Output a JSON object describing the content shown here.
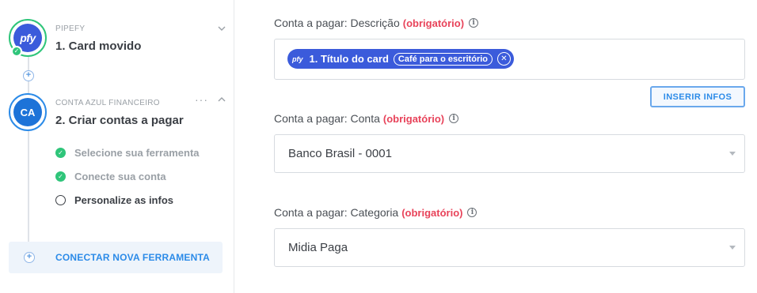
{
  "sidebar": {
    "steps": [
      {
        "app": "PIPEFY",
        "title": "1. Card movido",
        "avatar_text": "pfy",
        "status": "done"
      },
      {
        "app": "CONTA AZUL FINANCEIRO",
        "title": "2. Criar contas a pagar",
        "avatar_text": "CA",
        "more": "···",
        "substeps": [
          {
            "label": "Selecione sua ferramenta",
            "state": "done"
          },
          {
            "label": "Conecte sua conta",
            "state": "done"
          },
          {
            "label": "Personalize as infos",
            "state": "current"
          }
        ]
      }
    ],
    "connect_button": "CONECTAR NOVA FERRAMENTA"
  },
  "form": {
    "fields": [
      {
        "label": "Conta a pagar: Descrição",
        "required": "(obrigatório)",
        "token": {
          "app": "pfy",
          "name": "1. Título do card",
          "value": "Café para o escritório"
        }
      },
      {
        "label": "Conta a pagar: Conta",
        "required": "(obrigatório)",
        "value": "Banco Brasil - 0001"
      },
      {
        "label": "Conta a pagar: Categoria",
        "required": "(obrigatório)",
        "value": "Midia Paga"
      }
    ],
    "insert_button": "INSERIR INFOS"
  },
  "colors": {
    "primary_blue": "#2c8be8",
    "pipefy_blue": "#3b5bdb",
    "success_green": "#2fc57a",
    "required_red": "#e8435a"
  }
}
